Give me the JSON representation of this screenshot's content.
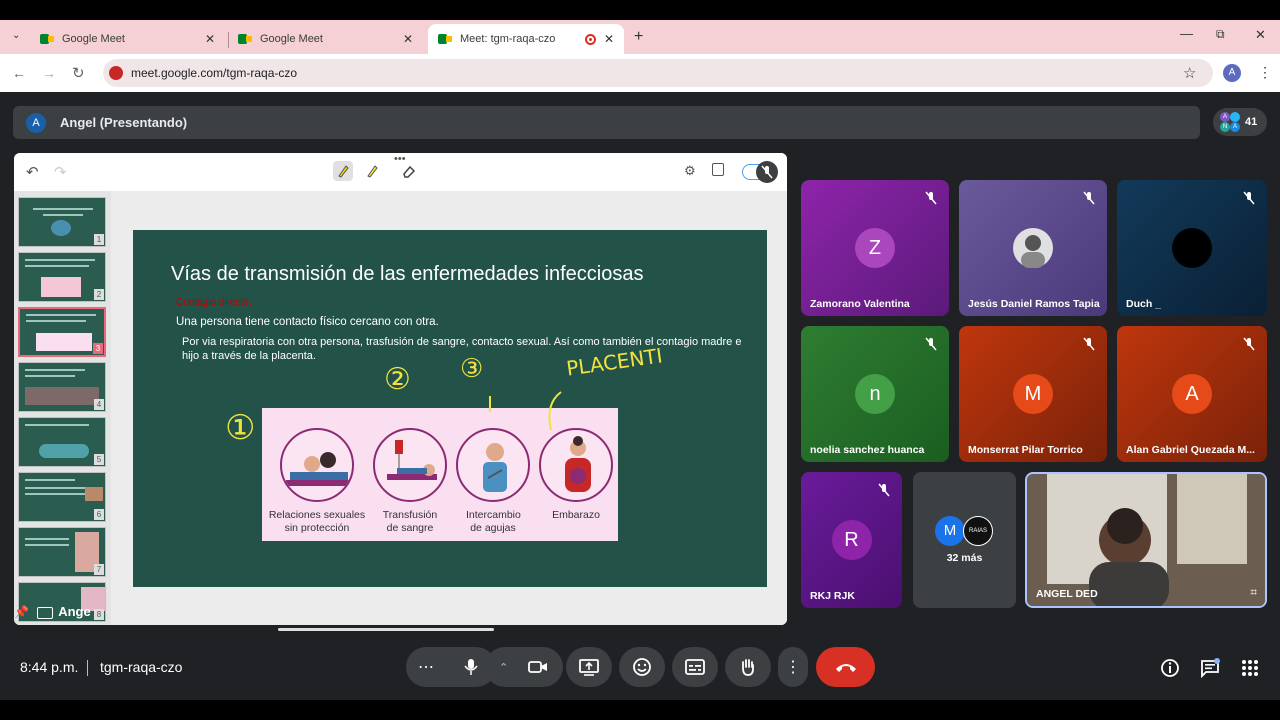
{
  "browser": {
    "tabs": [
      {
        "title": "Google Meet",
        "active": false
      },
      {
        "title": "Google Meet",
        "active": false
      },
      {
        "title": "Meet: tgm-raqa-czo",
        "active": true
      }
    ],
    "url": "meet.google.com/tgm-raqa-czo",
    "profile_initial": "A"
  },
  "presenting": {
    "avatar_initial": "A",
    "label": "Angel (Presentando)",
    "participant_count": "41"
  },
  "slide": {
    "title": "Vías de transmisión de las enfermedades infecciosas",
    "subheading": "Contagio directo:",
    "line1": "Una persona tiene contacto físico cercano con otra.",
    "line2": "Por via respiratoria con otra persona, trasfusión de sangre, contacto sexual. Así como también el contagio madre e hijo a través de la placenta.",
    "panel": [
      {
        "caption": "Relaciones sexuales sin protección"
      },
      {
        "caption": "Transfusión de sangre"
      },
      {
        "caption": "Intercambio de agujas"
      },
      {
        "caption": "Embarazo"
      }
    ],
    "annotations": {
      "one": "①",
      "two": "②",
      "three": "③",
      "placenta": "PLACENTI"
    }
  },
  "thumbnails": [
    "1",
    "2",
    "3",
    "4",
    "5",
    "6",
    "7",
    "8"
  ],
  "thumb_overlay_text": "Ange",
  "tiles": [
    {
      "name": "Zamorano Valentina",
      "initial": "Z",
      "bg": "#7b1fa2",
      "avatar_color": "#ab47bc"
    },
    {
      "name": "Jesús Daniel Ramos Tapia",
      "initial": "",
      "bg": "#6a4e9b",
      "avatar_color": "#ddd"
    },
    {
      "name": "Duch _",
      "initial": "",
      "bg": "#102a43",
      "avatar_color": "#000"
    },
    {
      "name": "noelia sanchez huanca",
      "initial": "n",
      "bg": "#2e7d32",
      "avatar_color": "#43a047"
    },
    {
      "name": "Monserrat Pilar Torrico",
      "initial": "M",
      "bg": "#bf360c",
      "avatar_color": "#e64a19"
    },
    {
      "name": "Alan Gabriel Quezada M...",
      "initial": "A",
      "bg": "#bf360c",
      "avatar_color": "#e64a19"
    },
    {
      "name": "RKJ RJK",
      "initial": "R",
      "bg": "#6a1b9a",
      "avatar_color": "#8e24aa"
    },
    {
      "name": "ANGEL DED",
      "initial": "",
      "bg": "#5d5147",
      "avatar_color": ""
    }
  ],
  "more": {
    "label": "32 más",
    "avatar1": "M",
    "avatar2": "RAIAS"
  },
  "bottom": {
    "time": "8:44 p.m.",
    "meeting_code": "tgm-raqa-czo"
  }
}
